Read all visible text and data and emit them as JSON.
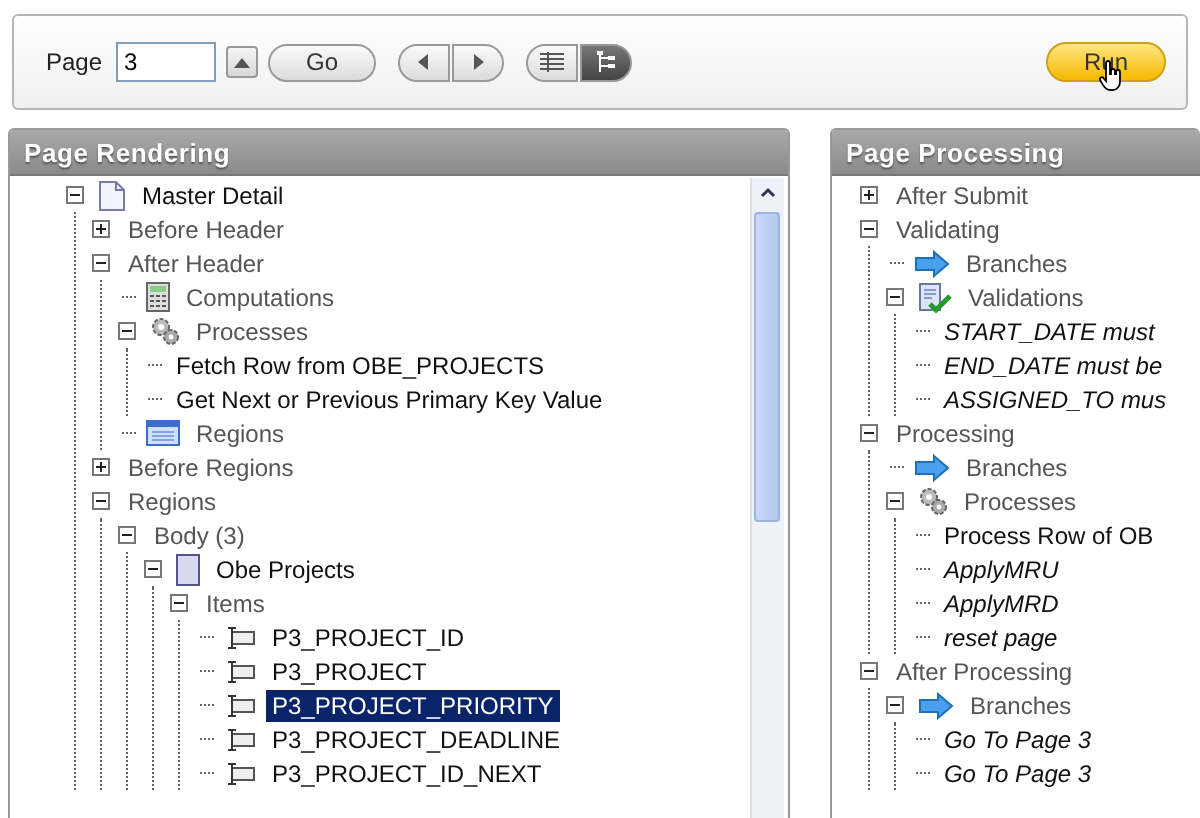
{
  "toolbar": {
    "page_label": "Page",
    "page_value": "3",
    "go": "Go",
    "views": [
      {
        "kind": "list",
        "selected": false
      },
      {
        "kind": "tree",
        "selected": true
      }
    ],
    "run": "Run"
  },
  "panels": [
    {
      "title": "Page Rendering",
      "has_scrollbar": true,
      "tree": [
        {
          "label": "Master Detail",
          "kind": "page",
          "expanded": true,
          "children": [
            {
              "label": "Before Header",
              "kind": "group",
              "expanded": false
            },
            {
              "label": "After Header",
              "kind": "group",
              "expanded": true,
              "children": [
                {
                  "label": "Computations",
                  "kind": "computation-group"
                },
                {
                  "label": "Processes",
                  "kind": "process-group",
                  "expanded": true,
                  "children": [
                    {
                      "label": "Fetch Row from OBE_PROJECTS",
                      "kind": "process"
                    },
                    {
                      "label": "Get Next or Previous Primary Key Value",
                      "kind": "process"
                    }
                  ]
                },
                {
                  "label": "Regions",
                  "kind": "region-group"
                }
              ]
            },
            {
              "label": "Before Regions",
              "kind": "group",
              "expanded": false
            },
            {
              "label": "Regions",
              "kind": "group",
              "expanded": true,
              "children": [
                {
                  "label": "Body (3)",
                  "kind": "group",
                  "expanded": true,
                  "children": [
                    {
                      "label": "Obe Projects",
                      "kind": "region",
                      "expanded": true,
                      "children": [
                        {
                          "label": "Items",
                          "kind": "group",
                          "expanded": true,
                          "children": [
                            {
                              "label": "P3_PROJECT_ID",
                              "kind": "item",
                              "selected": false
                            },
                            {
                              "label": "P3_PROJECT",
                              "kind": "item",
                              "selected": false
                            },
                            {
                              "label": "P3_PROJECT_PRIORITY",
                              "kind": "item",
                              "selected": true
                            },
                            {
                              "label": "P3_PROJECT_DEADLINE",
                              "kind": "item",
                              "selected": false
                            },
                            {
                              "label": "P3_PROJECT_ID_NEXT",
                              "kind": "item",
                              "selected": false
                            }
                          ]
                        }
                      ]
                    }
                  ]
                }
              ]
            }
          ]
        }
      ]
    },
    {
      "title": "Page Processing",
      "has_scrollbar": false,
      "tree": [
        {
          "label": "After Submit",
          "kind": "group",
          "expanded": false
        },
        {
          "label": "Validating",
          "kind": "group",
          "expanded": true,
          "children": [
            {
              "label": "Branches",
              "kind": "branch-group"
            },
            {
              "label": "Validations",
              "kind": "validation-group",
              "expanded": true,
              "children": [
                {
                  "label": "START_DATE must",
                  "kind": "conditional"
                },
                {
                  "label": "END_DATE must be",
                  "kind": "conditional"
                },
                {
                  "label": "ASSIGNED_TO mus",
                  "kind": "conditional"
                }
              ]
            }
          ]
        },
        {
          "label": "Processing",
          "kind": "group",
          "expanded": true,
          "children": [
            {
              "label": "Branches",
              "kind": "branch-group"
            },
            {
              "label": "Processes",
              "kind": "process-group",
              "expanded": true,
              "children": [
                {
                  "label": "Process Row of OB",
                  "kind": "process"
                },
                {
                  "label": "ApplyMRU",
                  "kind": "conditional"
                },
                {
                  "label": "ApplyMRD",
                  "kind": "conditional"
                },
                {
                  "label": "reset page",
                  "kind": "conditional"
                }
              ]
            }
          ]
        },
        {
          "label": "After Processing",
          "kind": "group",
          "expanded": true,
          "children": [
            {
              "label": "Branches",
              "kind": "branch-group",
              "expanded": true,
              "children": [
                {
                  "label": "Go To Page 3",
                  "kind": "conditional"
                },
                {
                  "label": "Go To Page 3",
                  "kind": "conditional"
                }
              ]
            }
          ]
        }
      ]
    }
  ]
}
